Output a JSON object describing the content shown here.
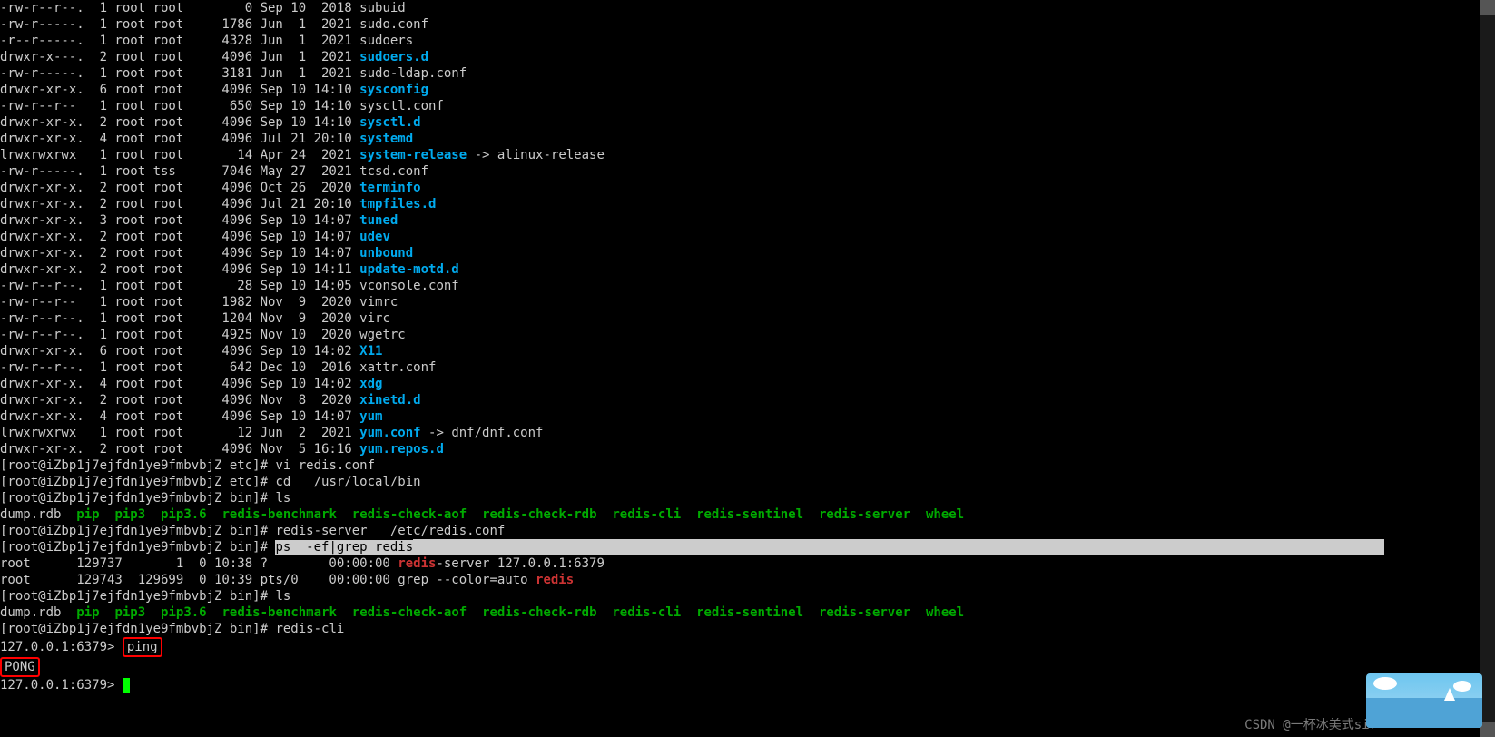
{
  "listing": [
    {
      "perm": "-rw-r--r--.",
      "links": "1",
      "owner": "root",
      "group": "root",
      "size": "0",
      "date": "Sep 10  2018",
      "name": "subuid",
      "cls": "file"
    },
    {
      "perm": "-rw-r-----.",
      "links": "1",
      "owner": "root",
      "group": "root",
      "size": "1786",
      "date": "Jun  1  2021",
      "name": "sudo.conf",
      "cls": "file"
    },
    {
      "perm": "-r--r-----.",
      "links": "1",
      "owner": "root",
      "group": "root",
      "size": "4328",
      "date": "Jun  1  2021",
      "name": "sudoers",
      "cls": "file"
    },
    {
      "perm": "drwxr-x---.",
      "links": "2",
      "owner": "root",
      "group": "root",
      "size": "4096",
      "date": "Jun  1  2021",
      "name": "sudoers.d",
      "cls": "dir"
    },
    {
      "perm": "-rw-r-----.",
      "links": "1",
      "owner": "root",
      "group": "root",
      "size": "3181",
      "date": "Jun  1  2021",
      "name": "sudo-ldap.conf",
      "cls": "file"
    },
    {
      "perm": "drwxr-xr-x.",
      "links": "6",
      "owner": "root",
      "group": "root",
      "size": "4096",
      "date": "Sep 10 14:10",
      "name": "sysconfig",
      "cls": "dir"
    },
    {
      "perm": "-rw-r--r--",
      "links": "1",
      "owner": "root",
      "group": "root",
      "size": "650",
      "date": "Sep 10 14:10",
      "name": "sysctl.conf",
      "cls": "file"
    },
    {
      "perm": "drwxr-xr-x.",
      "links": "2",
      "owner": "root",
      "group": "root",
      "size": "4096",
      "date": "Sep 10 14:10",
      "name": "sysctl.d",
      "cls": "dir"
    },
    {
      "perm": "drwxr-xr-x.",
      "links": "4",
      "owner": "root",
      "group": "root",
      "size": "4096",
      "date": "Jul 21 20:10",
      "name": "systemd",
      "cls": "dir"
    },
    {
      "perm": "lrwxrwxrwx",
      "links": "1",
      "owner": "root",
      "group": "root",
      "size": "14",
      "date": "Apr 24  2021",
      "name": "system-release",
      "cls": "link",
      "arrow": " -> ",
      "target": "alinux-release"
    },
    {
      "perm": "-rw-r-----.",
      "links": "1",
      "owner": "root",
      "group": "tss",
      "size": "7046",
      "date": "May 27  2021",
      "name": "tcsd.conf",
      "cls": "file"
    },
    {
      "perm": "drwxr-xr-x.",
      "links": "2",
      "owner": "root",
      "group": "root",
      "size": "4096",
      "date": "Oct 26  2020",
      "name": "terminfo",
      "cls": "dir"
    },
    {
      "perm": "drwxr-xr-x.",
      "links": "2",
      "owner": "root",
      "group": "root",
      "size": "4096",
      "date": "Jul 21 20:10",
      "name": "tmpfiles.d",
      "cls": "dir"
    },
    {
      "perm": "drwxr-xr-x.",
      "links": "3",
      "owner": "root",
      "group": "root",
      "size": "4096",
      "date": "Sep 10 14:07",
      "name": "tuned",
      "cls": "dir"
    },
    {
      "perm": "drwxr-xr-x.",
      "links": "2",
      "owner": "root",
      "group": "root",
      "size": "4096",
      "date": "Sep 10 14:07",
      "name": "udev",
      "cls": "dir"
    },
    {
      "perm": "drwxr-xr-x.",
      "links": "2",
      "owner": "root",
      "group": "root",
      "size": "4096",
      "date": "Sep 10 14:07",
      "name": "unbound",
      "cls": "dir"
    },
    {
      "perm": "drwxr-xr-x.",
      "links": "2",
      "owner": "root",
      "group": "root",
      "size": "4096",
      "date": "Sep 10 14:11",
      "name": "update-motd.d",
      "cls": "dir"
    },
    {
      "perm": "-rw-r--r--.",
      "links": "1",
      "owner": "root",
      "group": "root",
      "size": "28",
      "date": "Sep 10 14:05",
      "name": "vconsole.conf",
      "cls": "file"
    },
    {
      "perm": "-rw-r--r--",
      "links": "1",
      "owner": "root",
      "group": "root",
      "size": "1982",
      "date": "Nov  9  2020",
      "name": "vimrc",
      "cls": "file"
    },
    {
      "perm": "-rw-r--r--.",
      "links": "1",
      "owner": "root",
      "group": "root",
      "size": "1204",
      "date": "Nov  9  2020",
      "name": "virc",
      "cls": "file"
    },
    {
      "perm": "-rw-r--r--.",
      "links": "1",
      "owner": "root",
      "group": "root",
      "size": "4925",
      "date": "Nov 10  2020",
      "name": "wgetrc",
      "cls": "file"
    },
    {
      "perm": "drwxr-xr-x.",
      "links": "6",
      "owner": "root",
      "group": "root",
      "size": "4096",
      "date": "Sep 10 14:02",
      "name": "X11",
      "cls": "dir"
    },
    {
      "perm": "-rw-r--r--.",
      "links": "1",
      "owner": "root",
      "group": "root",
      "size": "642",
      "date": "Dec 10  2016",
      "name": "xattr.conf",
      "cls": "file"
    },
    {
      "perm": "drwxr-xr-x.",
      "links": "4",
      "owner": "root",
      "group": "root",
      "size": "4096",
      "date": "Sep 10 14:02",
      "name": "xdg",
      "cls": "dir"
    },
    {
      "perm": "drwxr-xr-x.",
      "links": "2",
      "owner": "root",
      "group": "root",
      "size": "4096",
      "date": "Nov  8  2020",
      "name": "xinetd.d",
      "cls": "dir"
    },
    {
      "perm": "drwxr-xr-x.",
      "links": "4",
      "owner": "root",
      "group": "root",
      "size": "4096",
      "date": "Sep 10 14:07",
      "name": "yum",
      "cls": "dir"
    },
    {
      "perm": "lrwxrwxrwx",
      "links": "1",
      "owner": "root",
      "group": "root",
      "size": "12",
      "date": "Jun  2  2021",
      "name": "yum.conf",
      "cls": "link",
      "arrow": " -> ",
      "target": "dnf/dnf.conf"
    },
    {
      "perm": "drwxr-xr-x.",
      "links": "2",
      "owner": "root",
      "group": "root",
      "size": "4096",
      "date": "Nov  5 16:16",
      "name": "yum.repos.d",
      "cls": "dir"
    }
  ],
  "prompts": {
    "etc": "[root@iZbp1j7ejfdn1ye9fmbvbjZ etc]# ",
    "bin": "[root@iZbp1j7ejfdn1ye9fmbvbjZ bin]# ",
    "redis": "127.0.0.1:6379> "
  },
  "cmds": {
    "vi": "vi redis.conf",
    "cd": "cd   /usr/local/bin",
    "ls": "ls",
    "server": "redis-server   /etc/redis.conf",
    "grep": "ps  -ef|grep redis",
    "cli": "redis-cli",
    "ping": "ping"
  },
  "binlist": {
    "dump": "dump.rdb",
    "pip": "pip",
    "pip3": "pip3",
    "pip36": "pip3.6",
    "rbm": "redis-benchmark",
    "rca": "redis-check-aof",
    "rcr": "redis-check-rdb",
    "rcli": "redis-cli",
    "rsent": "redis-sentinel",
    "rsrv": "redis-server",
    "wheel": "wheel"
  },
  "ps": {
    "l1_pre": "root      129737       1  0 10:38 ?        00:00:00 ",
    "l1_hl": "redis",
    "l1_post": "-server 127.0.0.1:6379",
    "l2_pre": "root      129743  129699  0 10:39 pts/0    00:00:00 grep --color=auto ",
    "l2_hl": "redis"
  },
  "pong": "PONG",
  "watermark": "CSDN @一杯冰美式sir"
}
